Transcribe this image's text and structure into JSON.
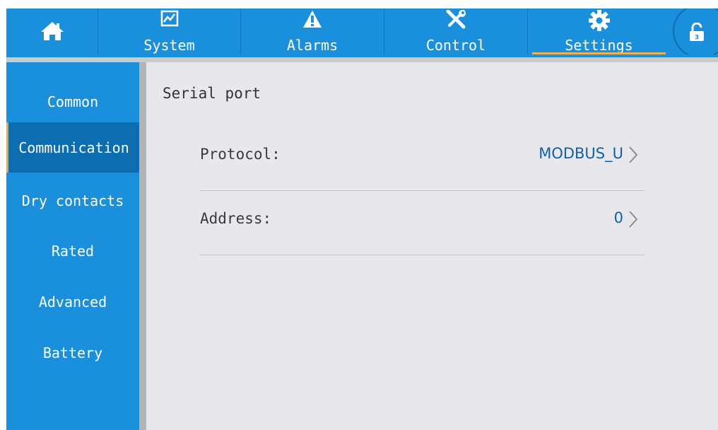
{
  "nav": {
    "home": {
      "icon": "home-icon"
    },
    "tabs": [
      {
        "label": "System",
        "icon": "chart-icon"
      },
      {
        "label": "Alarms",
        "icon": "warning-icon"
      },
      {
        "label": "Control",
        "icon": "tools-icon"
      },
      {
        "label": "Settings",
        "icon": "gear-icon",
        "active": true
      }
    ],
    "lock": {
      "icon": "unlock-icon",
      "badge": "3"
    }
  },
  "sidebar": {
    "items": [
      {
        "label": "Common"
      },
      {
        "label": "Communication",
        "active": true
      },
      {
        "label": "Dry contacts"
      },
      {
        "label": "Rated"
      },
      {
        "label": "Advanced"
      },
      {
        "label": "Battery"
      }
    ]
  },
  "content": {
    "section_title": "Serial port",
    "rows": [
      {
        "label": "Protocol:",
        "value": "MODBUS_U"
      },
      {
        "label": "Address:",
        "value": "0"
      }
    ]
  },
  "colors": {
    "primary": "#1a8fdb",
    "active_sidebar": "#0c6db0",
    "accent": "#f0b050",
    "value_text": "#1160a6",
    "content_bg": "#e8e8ec"
  }
}
